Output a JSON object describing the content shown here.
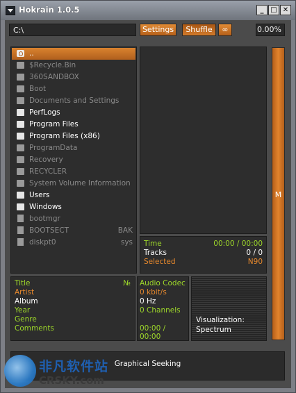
{
  "window": {
    "title": "Hokrain 1.0.5"
  },
  "toolbar": {
    "path": "C:\\",
    "settings": "Settings",
    "shuffle": "Shuffle",
    "loop": "∞",
    "progress": "0.00%"
  },
  "browser": {
    "items": [
      {
        "label": "..",
        "ext": ""
      },
      {
        "label": "$Recycle.Bin",
        "ext": ""
      },
      {
        "label": "360SANDBOX",
        "ext": ""
      },
      {
        "label": "Boot",
        "ext": ""
      },
      {
        "label": "Documents and Settings",
        "ext": ""
      },
      {
        "label": "PerfLogs",
        "ext": ""
      },
      {
        "label": "Program Files",
        "ext": ""
      },
      {
        "label": "Program Files (x86)",
        "ext": ""
      },
      {
        "label": "ProgramData",
        "ext": ""
      },
      {
        "label": "Recovery",
        "ext": ""
      },
      {
        "label": "RECYCLER",
        "ext": ""
      },
      {
        "label": "System Volume Information",
        "ext": ""
      },
      {
        "label": "Users",
        "ext": ""
      },
      {
        "label": "Windows",
        "ext": ""
      },
      {
        "label": "bootmgr",
        "ext": ""
      },
      {
        "label": "BOOTSECT",
        "ext": "BAK"
      },
      {
        "label": "diskpt0",
        "ext": "sys"
      }
    ]
  },
  "stats": {
    "time_label": "Time",
    "time_value": "00:00 / 00:00",
    "tracks_label": "Tracks",
    "tracks_value": "0 / 0",
    "selected_label": "Selected",
    "selected_value": "N90"
  },
  "side_button": "M",
  "tags": {
    "title": "Title",
    "number": "№",
    "artist": "Artist",
    "album": "Album",
    "year": "Year",
    "genre": "Genre",
    "comments": "Comments"
  },
  "codec": {
    "label": "Audio Codec",
    "bitrate": "0 kbit/s",
    "rate": "0 Hz",
    "channels": "0 Channels",
    "time": "00:00 / 00:00"
  },
  "visualization": {
    "label": "Visualization:",
    "mode": "Spectrum"
  },
  "seek": {
    "label": "Graphical Seeking"
  },
  "watermark": {
    "cn": "非凡软件站",
    "en": "CRSKY.com"
  },
  "colors": {
    "accent": "#d9822f",
    "green": "#9ed82a",
    "panel": "#2d2d2d"
  }
}
